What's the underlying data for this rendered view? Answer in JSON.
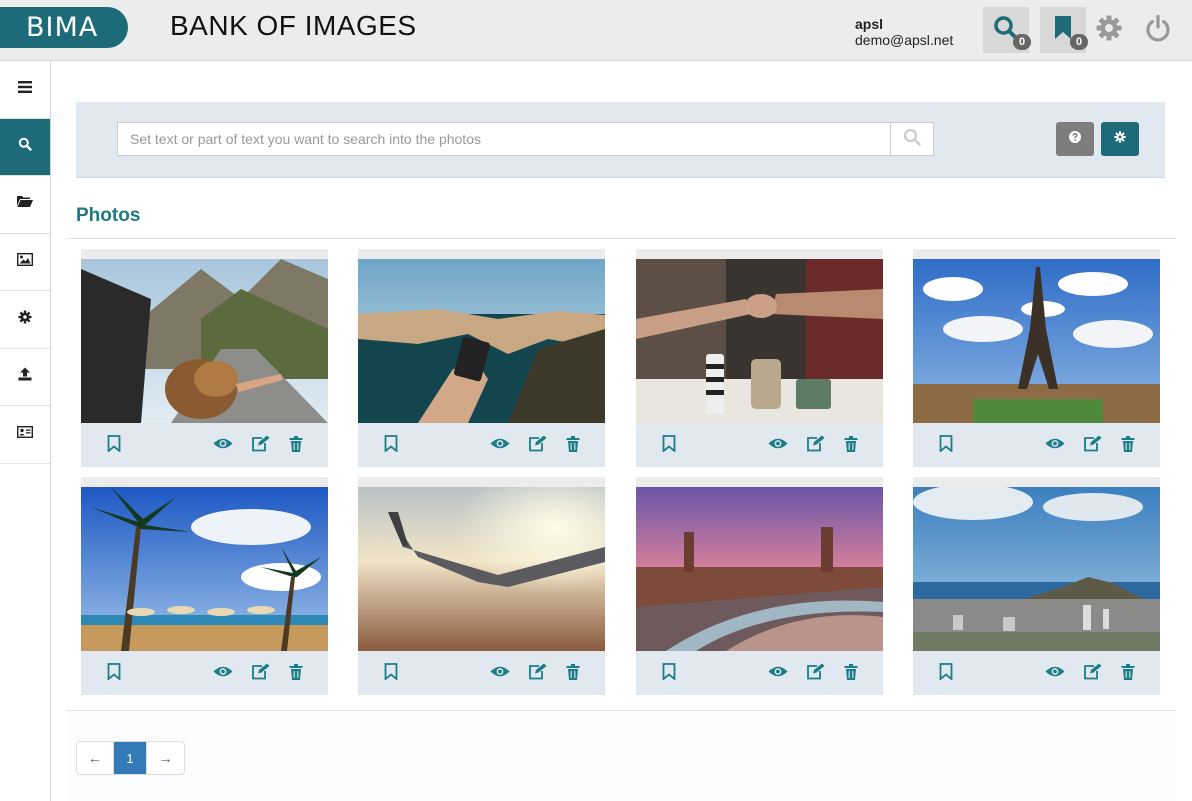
{
  "header": {
    "brand": "BIMA",
    "title": "BANK OF IMAGES",
    "user_name": "apsl",
    "user_email": "demo@apsl.net",
    "search_count": "0",
    "bookmark_count": "0",
    "accent_color": "#1d6a78"
  },
  "sidebar": {
    "items": [
      {
        "name": "menu-icon",
        "active": false
      },
      {
        "name": "search-icon",
        "active": true
      },
      {
        "name": "folder-open-icon",
        "active": false
      },
      {
        "name": "image-icon",
        "active": false
      },
      {
        "name": "gear-icon",
        "active": false
      },
      {
        "name": "upload-icon",
        "active": false
      },
      {
        "name": "id-card-icon",
        "active": false
      }
    ]
  },
  "search": {
    "placeholder": "Set text or part of text you want to search into the photos",
    "value": ""
  },
  "section": {
    "title": "Photos"
  },
  "photos": [
    {
      "scene": "woman-in-car-mountain-road"
    },
    {
      "scene": "hand-holding-phone-coastal-cliffs"
    },
    {
      "scene": "fist-bump-over-table"
    },
    {
      "scene": "eiffel-tower-cloudy-sky"
    },
    {
      "scene": "tropical-beach-palm-trees"
    },
    {
      "scene": "airplane-wing-sunset"
    },
    {
      "scene": "plaza-de-espana-dusk"
    },
    {
      "scene": "city-with-mountain-coast"
    }
  ],
  "pagination": {
    "prev": "←",
    "current": "1",
    "next": "→"
  }
}
